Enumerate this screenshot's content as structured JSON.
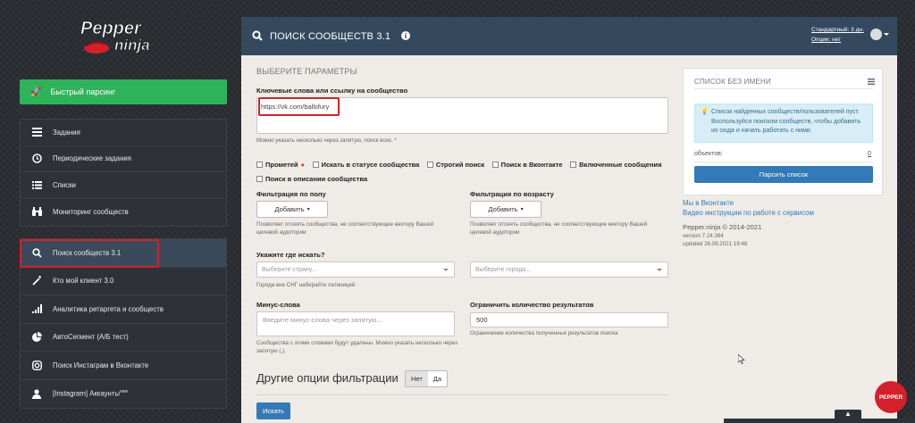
{
  "logo": {
    "line1": "Pepper",
    "line2": "ninja"
  },
  "sidebar": {
    "fast_parse": "Быстрый парсинг",
    "group1": [
      {
        "label": "Задания",
        "icon": "tasks-icon"
      },
      {
        "label": "Периодические задания",
        "icon": "clock-icon"
      },
      {
        "label": "Списки",
        "icon": "list-icon"
      },
      {
        "label": "Мониторинг сообществ",
        "icon": "binoculars-icon"
      }
    ],
    "group2": [
      {
        "label": "Поиск сообществ 3.1",
        "icon": "search-icon",
        "active": true
      },
      {
        "label": "Кто мой клиент 3.0",
        "icon": "magic-wand-icon"
      },
      {
        "label": "Аналитика ретаргета и сообществ",
        "icon": "signal-bars-icon"
      },
      {
        "label": "АвтоСегмент (А/Б тест)",
        "icon": "pie-chart-icon"
      },
      {
        "label": "Поиск Инстаграм в Вконтакте",
        "icon": "instagram-icon"
      },
      {
        "label": "[Instagram] Аккаунты",
        "icon": "user-icon",
        "sup": "new"
      }
    ]
  },
  "header": {
    "title": "ПОИСК СООБЩЕСТВ 3.1",
    "plan_label": "Стандартный: 3 дн.",
    "options_label": "Опции: нет"
  },
  "form": {
    "section_title": "ВЫБЕРИТЕ ПАРАМЕТРЫ",
    "keywords_label": "Ключевые слова или ссылку на сообщество",
    "keywords_value": "https://vk.com/ballsfury",
    "keywords_hint": "Можно указать несколько через запятую, поиск всех. *",
    "checkboxes": [
      "Прометей",
      "Искать в статусе сообщества",
      "Строгий поиск",
      "Поиск в Вконтакте",
      "Включенные сообщения",
      "Поиск в описании сообщества"
    ],
    "gender_label": "Фильтрация по полу",
    "gender_button": "Добавить",
    "gender_hint": "Позволяет отсеять сообщества, не соответствующие вектору Вашей целевой аудитории",
    "age_label": "Фильтрация по возрасту",
    "age_button": "Добавить",
    "age_hint": "Позволяет отсеять сообщества, не соответствующие вектору Вашей целевой аудитории",
    "where_label": "Укажите где искать?",
    "country_placeholder": "Выберите страну...",
    "city_placeholder": "Выберите города...",
    "country_hint": "Города вне СНГ набирайте латиницей",
    "minus_label": "Минус-слова",
    "minus_placeholder": "Введите минус-слова через запятую...",
    "minus_hint": "Сообщества с этими словами будут удалены. Можно указать несколько через запятую (,).",
    "limit_label": "Ограничить количество результатов",
    "limit_value": "500",
    "limit_hint": "Ограничение количества полученных результатов поиска",
    "other_options": "Другие опции фильтрации",
    "toggle_no": "Нет",
    "toggle_yes": "Да",
    "search_button": "Искать"
  },
  "card": {
    "title": "СПИСОК БЕЗ ИМЕНИ",
    "info": "Список найденных сообществ/пользователей пуст. Воспользуйся поиском сообществ, чтобы добавить их сюда и начать работать с ними.",
    "objects_label": "объектов:",
    "objects_count": "0",
    "parse_button": "Парсить список"
  },
  "links": {
    "vk": "Мы в Вконтакте",
    "video": "Видео инструкции по работе с сервисом"
  },
  "footer": {
    "brand": "Pepper.ninja © 2014-2021",
    "version": "version 7.24.364",
    "updated": "updated 26.09.2021 19:48"
  },
  "badge": "PEPPER",
  "scroll_up": "▲",
  "colors": {
    "header": "#34495e",
    "green": "#2fb35a",
    "blue": "#337ab7",
    "highlight": "#d3212c"
  }
}
